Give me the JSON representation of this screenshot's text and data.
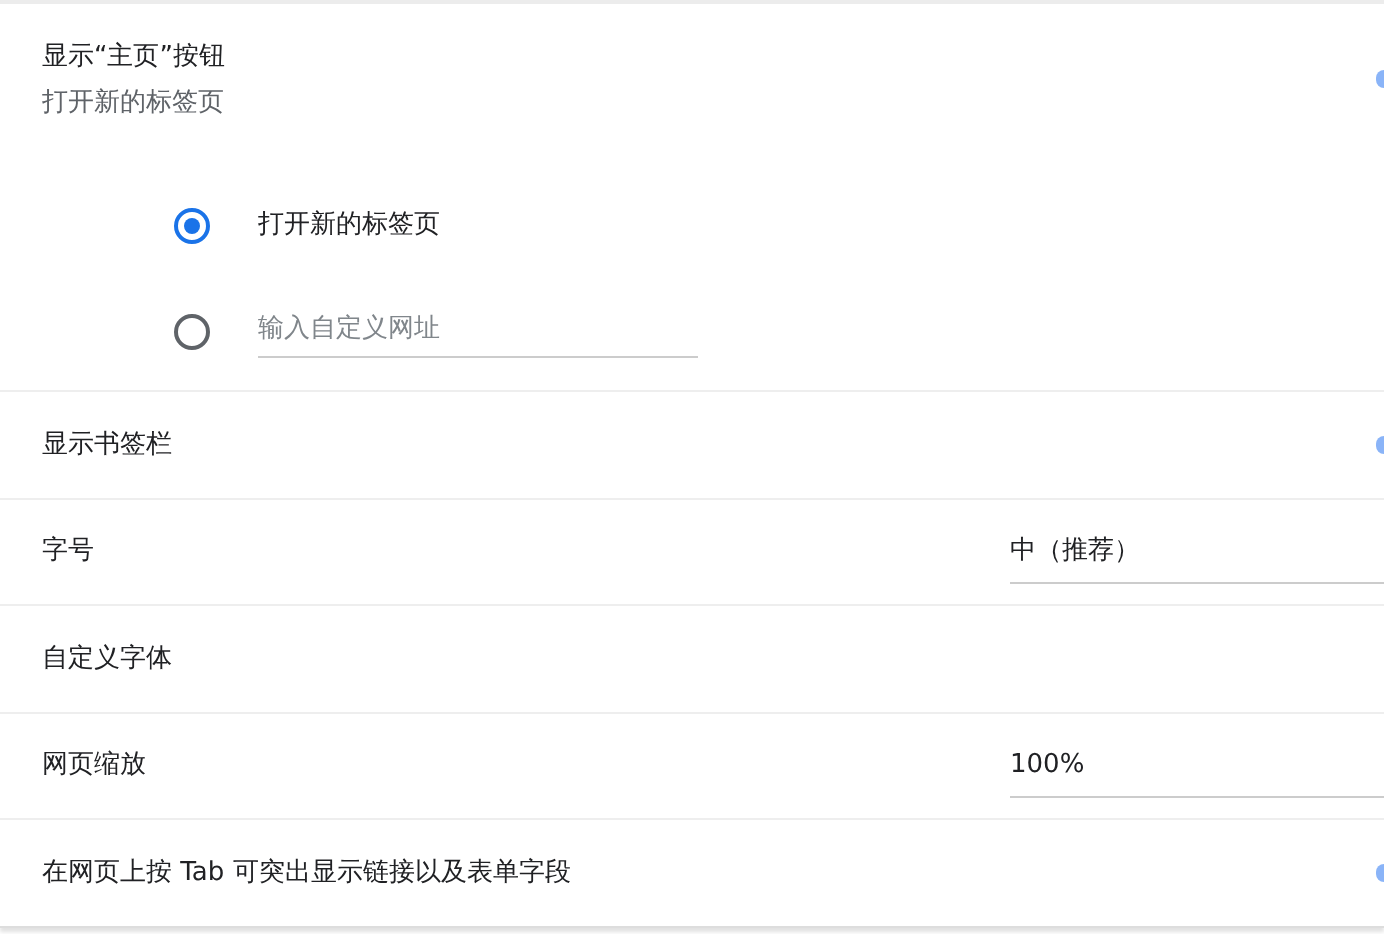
{
  "home_button": {
    "title": "显示“主页”按钮",
    "subtitle": "打开新的标签页",
    "on": true,
    "options": [
      {
        "kind": "label",
        "label": "打开新的标签页",
        "selected": true
      },
      {
        "kind": "input",
        "placeholder": "输入自定义网址",
        "selected": false
      }
    ]
  },
  "settings": [
    {
      "kind": "toggle",
      "label": "显示书签栏",
      "on": true
    },
    {
      "kind": "select",
      "label": "字号",
      "value": "中（推荐）"
    },
    {
      "kind": "plain",
      "label": "自定义字体"
    },
    {
      "kind": "select",
      "label": "网页缩放",
      "value": "100%"
    },
    {
      "kind": "toggle",
      "label": "在网页上按 Tab 可突出显示链接以及表单字段",
      "on": true
    }
  ]
}
